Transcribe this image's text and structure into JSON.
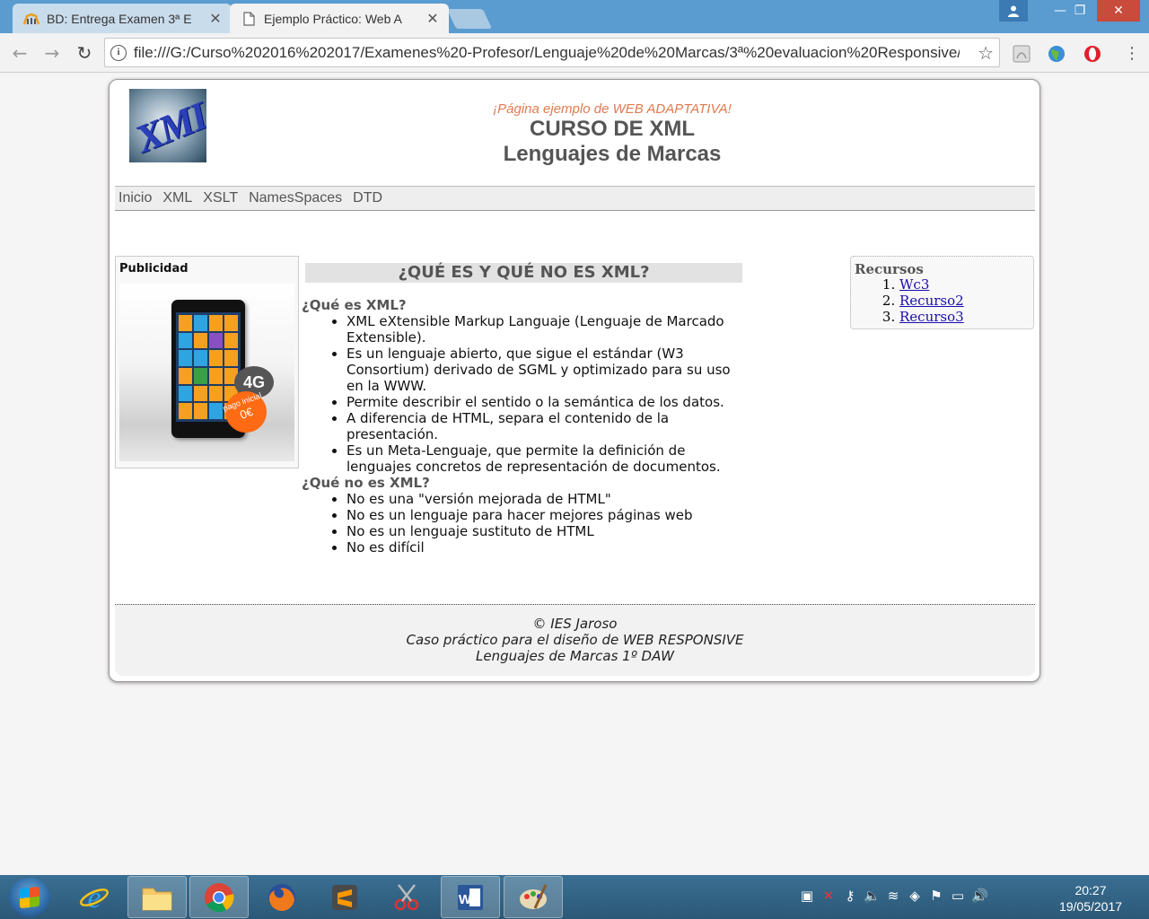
{
  "browser": {
    "tabs": [
      {
        "label": "BD: Entrega Examen 3ª E",
        "active": false,
        "icon": "moodle-icon"
      },
      {
        "label": "Ejemplo Práctico: Web A",
        "active": true,
        "icon": "page-icon"
      }
    ],
    "url": "file:///G:/Curso%202016%202017/Examenes%20-Profesor/Lenguaje%20de%20Marcas/3ª%20evaluacion%20Responsive/I",
    "window_buttons": {
      "minimize": "—",
      "maximize": "❐",
      "close": "✕"
    }
  },
  "page": {
    "logo_text": "XML",
    "tagline": "¡Página ejemplo de WEB ADAPTATIVA!",
    "title_line1": "CURSO DE XML",
    "title_line2": "Lenguajes de Marcas",
    "nav": [
      "Inicio",
      "XML",
      "XSLT",
      "NamesSpaces",
      "DTD"
    ],
    "ad": {
      "title": "Publicidad",
      "badge_4g": "4G",
      "badge_pay_text": "pago inicial",
      "badge_pay_price": "0€"
    },
    "main": {
      "heading": "¿QUÉ ES Y QUÉ NO ES XML?",
      "section1_title": "¿Qué es XML?",
      "section1_items": [
        "XML eXtensible Markup Languaje (Lenguaje de Marcado Extensible).",
        "Es un lenguaje abierto, que sigue el estándar (W3 Consortium) derivado de SGML y optimizado para su uso en la WWW.",
        "Permite describir el sentido o la semántica de los datos.",
        "A diferencia de HTML, separa el contenido de la presentación.",
        "Es un Meta-Lenguaje, que permite la definición de lenguajes concretos de representación de documentos."
      ],
      "section2_title": "¿Qué no es XML?",
      "section2_items": [
        "No es una \"versión mejorada de HTML\"",
        "No es un lenguaje para hacer mejores páginas web",
        "No es un lenguaje sustituto de HTML",
        "No es difícil"
      ]
    },
    "resources": {
      "title": "Recursos",
      "items": [
        "Wc3",
        "Recurso2",
        "Recurso3"
      ]
    },
    "footer": {
      "line1": "© IES Jaroso",
      "line2": "Caso práctico para el diseño de WEB RESPONSIVE",
      "line3": "Lenguajes de Marcas 1º DAW"
    }
  },
  "taskbar": {
    "apps": [
      "internet-explorer-icon",
      "file-explorer-icon",
      "chrome-icon",
      "firefox-icon",
      "sublime-text-icon",
      "snipping-tool-icon",
      "word-icon",
      "paint-icon"
    ],
    "time": "20:27",
    "date": "19/05/2017"
  },
  "colors": {
    "tagline": "#e07a50",
    "title": "#555555",
    "link": "#1a0dab",
    "titlebar": "#5a9bd0"
  }
}
